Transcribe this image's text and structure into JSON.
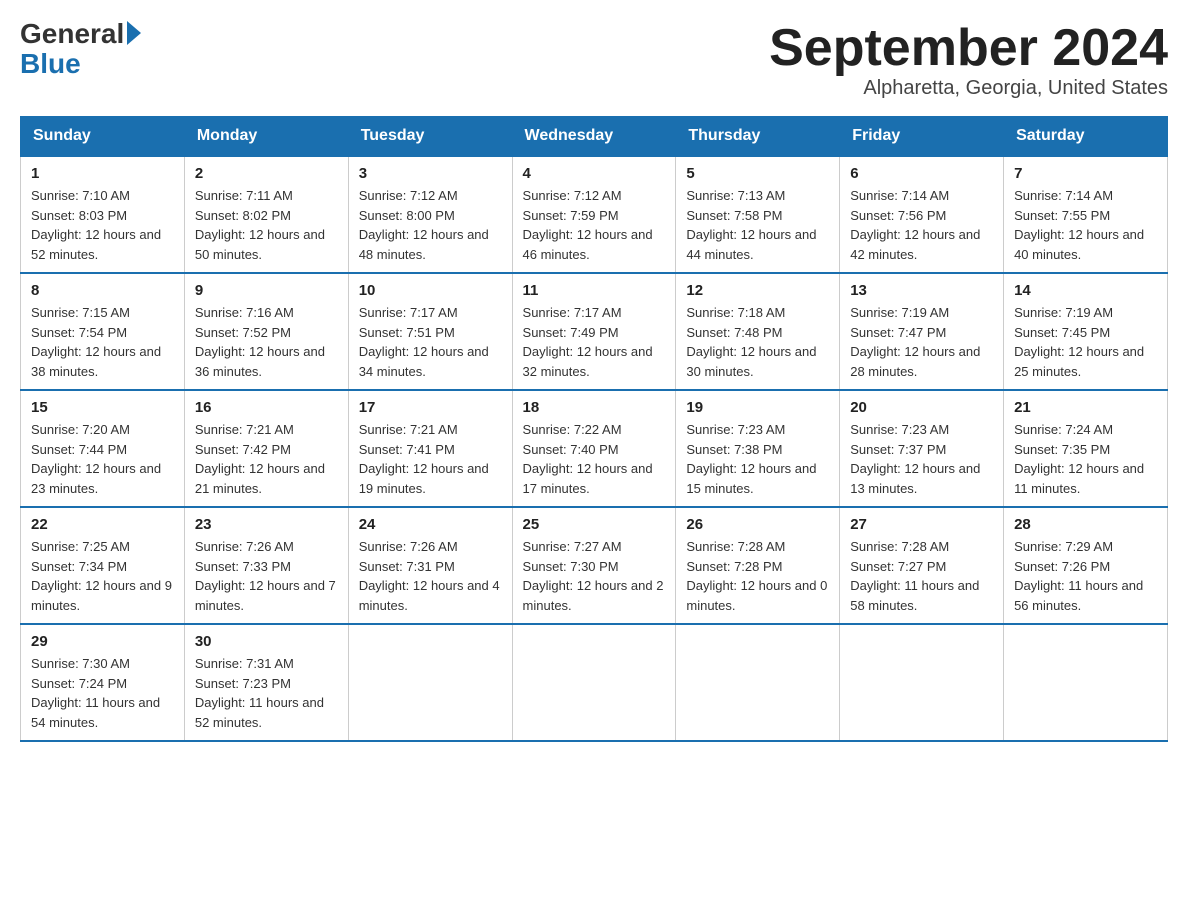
{
  "header": {
    "logo_general": "General",
    "logo_blue": "Blue",
    "month_title": "September 2024",
    "location": "Alpharetta, Georgia, United States"
  },
  "days_of_week": [
    "Sunday",
    "Monday",
    "Tuesday",
    "Wednesday",
    "Thursday",
    "Friday",
    "Saturday"
  ],
  "weeks": [
    [
      {
        "day": "1",
        "sunrise": "Sunrise: 7:10 AM",
        "sunset": "Sunset: 8:03 PM",
        "daylight": "Daylight: 12 hours and 52 minutes."
      },
      {
        "day": "2",
        "sunrise": "Sunrise: 7:11 AM",
        "sunset": "Sunset: 8:02 PM",
        "daylight": "Daylight: 12 hours and 50 minutes."
      },
      {
        "day": "3",
        "sunrise": "Sunrise: 7:12 AM",
        "sunset": "Sunset: 8:00 PM",
        "daylight": "Daylight: 12 hours and 48 minutes."
      },
      {
        "day": "4",
        "sunrise": "Sunrise: 7:12 AM",
        "sunset": "Sunset: 7:59 PM",
        "daylight": "Daylight: 12 hours and 46 minutes."
      },
      {
        "day": "5",
        "sunrise": "Sunrise: 7:13 AM",
        "sunset": "Sunset: 7:58 PM",
        "daylight": "Daylight: 12 hours and 44 minutes."
      },
      {
        "day": "6",
        "sunrise": "Sunrise: 7:14 AM",
        "sunset": "Sunset: 7:56 PM",
        "daylight": "Daylight: 12 hours and 42 minutes."
      },
      {
        "day": "7",
        "sunrise": "Sunrise: 7:14 AM",
        "sunset": "Sunset: 7:55 PM",
        "daylight": "Daylight: 12 hours and 40 minutes."
      }
    ],
    [
      {
        "day": "8",
        "sunrise": "Sunrise: 7:15 AM",
        "sunset": "Sunset: 7:54 PM",
        "daylight": "Daylight: 12 hours and 38 minutes."
      },
      {
        "day": "9",
        "sunrise": "Sunrise: 7:16 AM",
        "sunset": "Sunset: 7:52 PM",
        "daylight": "Daylight: 12 hours and 36 minutes."
      },
      {
        "day": "10",
        "sunrise": "Sunrise: 7:17 AM",
        "sunset": "Sunset: 7:51 PM",
        "daylight": "Daylight: 12 hours and 34 minutes."
      },
      {
        "day": "11",
        "sunrise": "Sunrise: 7:17 AM",
        "sunset": "Sunset: 7:49 PM",
        "daylight": "Daylight: 12 hours and 32 minutes."
      },
      {
        "day": "12",
        "sunrise": "Sunrise: 7:18 AM",
        "sunset": "Sunset: 7:48 PM",
        "daylight": "Daylight: 12 hours and 30 minutes."
      },
      {
        "day": "13",
        "sunrise": "Sunrise: 7:19 AM",
        "sunset": "Sunset: 7:47 PM",
        "daylight": "Daylight: 12 hours and 28 minutes."
      },
      {
        "day": "14",
        "sunrise": "Sunrise: 7:19 AM",
        "sunset": "Sunset: 7:45 PM",
        "daylight": "Daylight: 12 hours and 25 minutes."
      }
    ],
    [
      {
        "day": "15",
        "sunrise": "Sunrise: 7:20 AM",
        "sunset": "Sunset: 7:44 PM",
        "daylight": "Daylight: 12 hours and 23 minutes."
      },
      {
        "day": "16",
        "sunrise": "Sunrise: 7:21 AM",
        "sunset": "Sunset: 7:42 PM",
        "daylight": "Daylight: 12 hours and 21 minutes."
      },
      {
        "day": "17",
        "sunrise": "Sunrise: 7:21 AM",
        "sunset": "Sunset: 7:41 PM",
        "daylight": "Daylight: 12 hours and 19 minutes."
      },
      {
        "day": "18",
        "sunrise": "Sunrise: 7:22 AM",
        "sunset": "Sunset: 7:40 PM",
        "daylight": "Daylight: 12 hours and 17 minutes."
      },
      {
        "day": "19",
        "sunrise": "Sunrise: 7:23 AM",
        "sunset": "Sunset: 7:38 PM",
        "daylight": "Daylight: 12 hours and 15 minutes."
      },
      {
        "day": "20",
        "sunrise": "Sunrise: 7:23 AM",
        "sunset": "Sunset: 7:37 PM",
        "daylight": "Daylight: 12 hours and 13 minutes."
      },
      {
        "day": "21",
        "sunrise": "Sunrise: 7:24 AM",
        "sunset": "Sunset: 7:35 PM",
        "daylight": "Daylight: 12 hours and 11 minutes."
      }
    ],
    [
      {
        "day": "22",
        "sunrise": "Sunrise: 7:25 AM",
        "sunset": "Sunset: 7:34 PM",
        "daylight": "Daylight: 12 hours and 9 minutes."
      },
      {
        "day": "23",
        "sunrise": "Sunrise: 7:26 AM",
        "sunset": "Sunset: 7:33 PM",
        "daylight": "Daylight: 12 hours and 7 minutes."
      },
      {
        "day": "24",
        "sunrise": "Sunrise: 7:26 AM",
        "sunset": "Sunset: 7:31 PM",
        "daylight": "Daylight: 12 hours and 4 minutes."
      },
      {
        "day": "25",
        "sunrise": "Sunrise: 7:27 AM",
        "sunset": "Sunset: 7:30 PM",
        "daylight": "Daylight: 12 hours and 2 minutes."
      },
      {
        "day": "26",
        "sunrise": "Sunrise: 7:28 AM",
        "sunset": "Sunset: 7:28 PM",
        "daylight": "Daylight: 12 hours and 0 minutes."
      },
      {
        "day": "27",
        "sunrise": "Sunrise: 7:28 AM",
        "sunset": "Sunset: 7:27 PM",
        "daylight": "Daylight: 11 hours and 58 minutes."
      },
      {
        "day": "28",
        "sunrise": "Sunrise: 7:29 AM",
        "sunset": "Sunset: 7:26 PM",
        "daylight": "Daylight: 11 hours and 56 minutes."
      }
    ],
    [
      {
        "day": "29",
        "sunrise": "Sunrise: 7:30 AM",
        "sunset": "Sunset: 7:24 PM",
        "daylight": "Daylight: 11 hours and 54 minutes."
      },
      {
        "day": "30",
        "sunrise": "Sunrise: 7:31 AM",
        "sunset": "Sunset: 7:23 PM",
        "daylight": "Daylight: 11 hours and 52 minutes."
      },
      null,
      null,
      null,
      null,
      null
    ]
  ]
}
